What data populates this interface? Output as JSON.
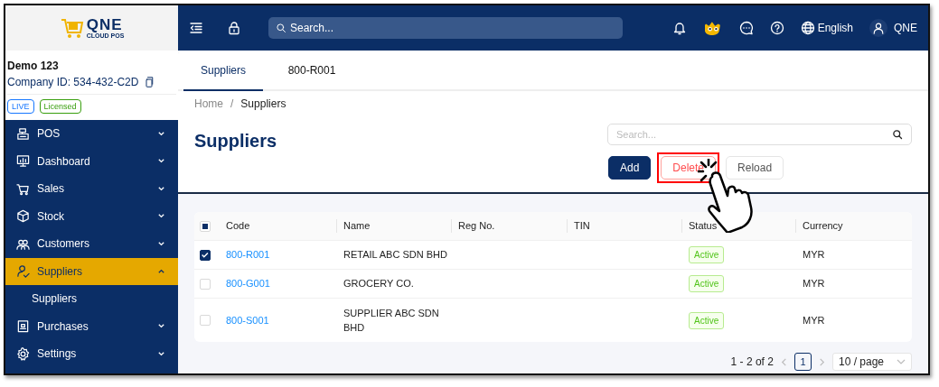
{
  "logo": {
    "name": "QNE",
    "tagline": "CLOUD POS"
  },
  "company": {
    "name": "Demo 123",
    "id": "Company ID: 534-432-C2D",
    "badges": [
      {
        "label": "LIVE",
        "color": "#1677ff"
      },
      {
        "label": "Licensed",
        "color": "#389e0d"
      }
    ]
  },
  "sidebar": {
    "items": [
      {
        "label": "POS",
        "expanded": false,
        "selected": false
      },
      {
        "label": "Dashboard",
        "expanded": false,
        "selected": false
      },
      {
        "label": "Sales",
        "expanded": false,
        "selected": false
      },
      {
        "label": "Stock",
        "expanded": false,
        "selected": false
      },
      {
        "label": "Customers",
        "expanded": false,
        "selected": false
      },
      {
        "label": "Suppliers",
        "expanded": true,
        "selected": true,
        "children": [
          {
            "label": "Suppliers"
          }
        ]
      },
      {
        "label": "Purchases",
        "expanded": false,
        "selected": false
      },
      {
        "label": "Settings",
        "expanded": false,
        "selected": false
      }
    ]
  },
  "topbar": {
    "search": {
      "placeholder": "Search..."
    },
    "language": "English",
    "user": "QNE"
  },
  "tabs": [
    {
      "label": "Suppliers",
      "selected": true
    },
    {
      "label": "800-R001",
      "selected": false
    }
  ],
  "breadcrumb": {
    "items": [
      "Home",
      "Suppliers"
    ],
    "separator": "/"
  },
  "page_title": "Suppliers",
  "table_search": {
    "placeholder": "Search..."
  },
  "buttons": [
    {
      "label": "Add",
      "kind": "primary",
      "highlighted": false
    },
    {
      "label": "Delete",
      "kind": "danger",
      "highlighted": true
    },
    {
      "label": "Reload",
      "kind": "default",
      "highlighted": false
    }
  ],
  "table": {
    "select_all_partial": true,
    "columns": [
      "Code",
      "Name",
      "Reg No.",
      "TIN",
      "Status",
      "Currency"
    ],
    "rows": [
      {
        "selected": true,
        "code": "800-R001",
        "name": "RETAIL ABC SDN BHD",
        "status": "Active",
        "currency": "MYR"
      },
      {
        "selected": false,
        "code": "800-G001",
        "name": "GROCERY CO.",
        "status": "Active",
        "currency": "MYR"
      },
      {
        "selected": false,
        "code": "800-S001",
        "name": "SUPPLIER ABC SDN BHD",
        "status": "Active",
        "currency": "MYR"
      }
    ]
  },
  "pagination": {
    "range": "1 - 2 of 2",
    "pages": [
      {
        "label": "1",
        "selected": true
      }
    ],
    "page_size": "10 / page"
  }
}
